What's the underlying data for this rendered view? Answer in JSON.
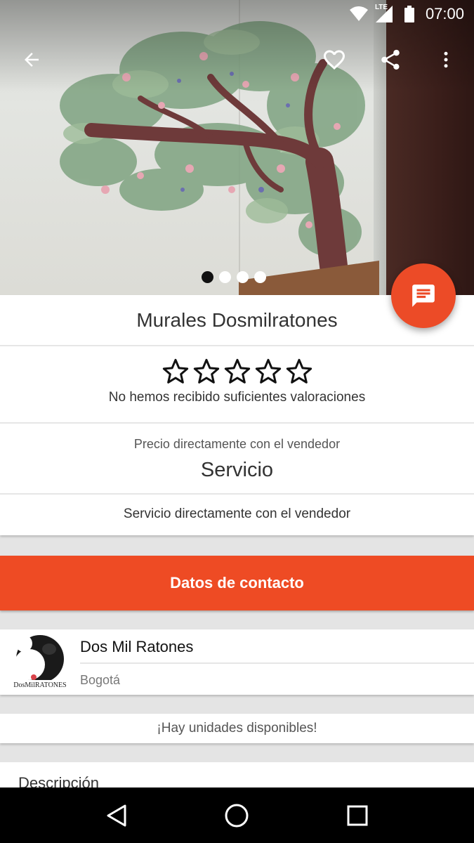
{
  "status_bar": {
    "time": "07:00",
    "network": "LTE"
  },
  "hero": {
    "image_alt": "mural of a tree on a wall",
    "page_count": 4,
    "active_page": 0
  },
  "listing": {
    "title": "Murales Dosmilratones",
    "rating": {
      "stars": 0,
      "max_stars": 5,
      "text": "No hemos recibido suficientes valoraciones"
    },
    "price_label": "Precio directamente con el vendedor",
    "price_value": "Servicio",
    "service_note": "Servicio directamente con el vendedor"
  },
  "contact_button": "Datos de contacto",
  "seller": {
    "name": "Dos Mil Ratones",
    "city": "Bogotá",
    "logo_text": "DosMilRATONES"
  },
  "availability": "¡Hay unidades disponibles!",
  "description_title": "Descripción",
  "colors": {
    "accent": "#ee4b24",
    "fab": "#ec4b27"
  }
}
